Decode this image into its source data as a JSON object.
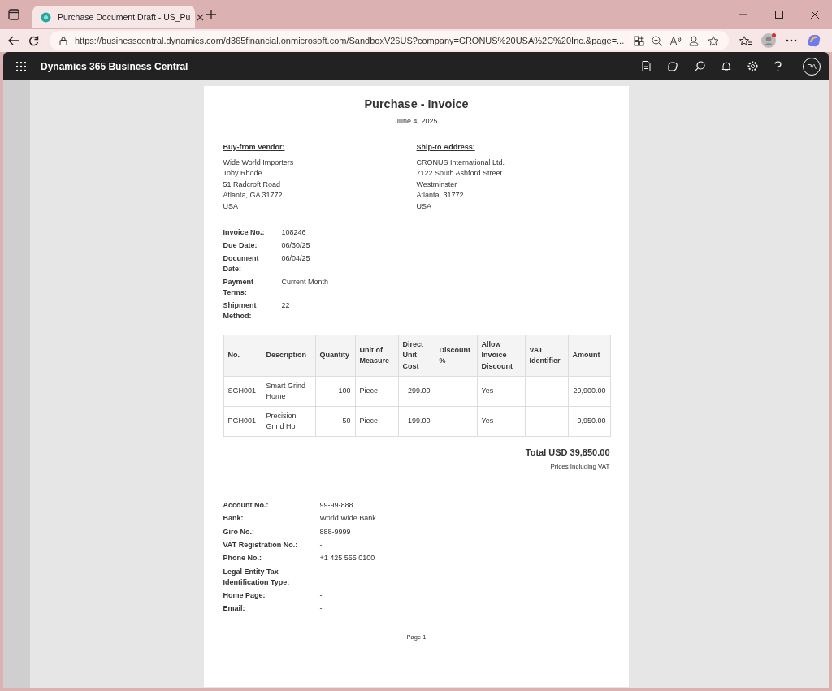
{
  "browser": {
    "tab_title": "Purchase Document Draft - US_Pu",
    "url": "https://businesscentral.dynamics.com/d365financial.onmicrosoft.com/SandboxV26US?company=CRONUS%20USA%2C%20Inc.&page=..."
  },
  "app_bar": {
    "title": "Dynamics 365 Business Central",
    "avatar": "PA"
  },
  "document": {
    "title": "Purchase - Invoice",
    "date": "June 4, 2025",
    "vendor": {
      "heading": "Buy-from Vendor:",
      "lines": [
        "Wide World Importers",
        "Toby Rhode",
        "51 Radcroft Road",
        "Atlanta, GA 31772",
        "USA"
      ]
    },
    "ship_to": {
      "heading": "Ship-to Address:",
      "lines": [
        "CRONUS International Ltd.",
        "7122 South Ashford Street",
        "Westminster",
        "Atlanta, 31772",
        "USA"
      ]
    },
    "fields": [
      {
        "label": "Invoice No.:",
        "value": "108246"
      },
      {
        "label": "Due Date:",
        "value": "06/30/25"
      },
      {
        "label": "Document Date:",
        "value": "06/04/25"
      },
      {
        "label": "Payment Terms:",
        "value": "Current Month"
      },
      {
        "label": "Shipment Method:",
        "value": "22"
      }
    ],
    "table": {
      "columns": [
        "No.",
        "Description",
        "Quantity",
        "Unit of Measure",
        "Direct Unit Cost",
        "Discount %",
        "Allow Invoice Discount",
        "VAT Identifier",
        "Amount"
      ],
      "rows": [
        [
          "SGH001",
          "Smart Grind Home",
          "100",
          "Piece",
          "299.00",
          "-",
          "Yes",
          "-",
          "29,900.00"
        ],
        [
          "PGH001",
          "Precision Grind Ho",
          "50",
          "Piece",
          "199.00",
          "-",
          "Yes",
          "-",
          "9,950.00"
        ]
      ]
    },
    "total": "Total USD 39,850.00",
    "total_note": "Prices Including VAT",
    "bank_fields": [
      {
        "label": "Account No.:",
        "value": "99-99-888"
      },
      {
        "label": "Bank:",
        "value": "World Wide Bank"
      },
      {
        "label": "Giro No.:",
        "value": "888-9999"
      },
      {
        "label": "VAT Registration No.:",
        "value": "-"
      },
      {
        "label": "Phone No.:",
        "value": "+1 425 555 0100"
      },
      {
        "label": "Legal Entity Tax Identification Type:",
        "value": "-"
      },
      {
        "label": "Home Page:",
        "value": "-"
      },
      {
        "label": "Email:",
        "value": "-"
      }
    ],
    "footer": "Page 1"
  }
}
